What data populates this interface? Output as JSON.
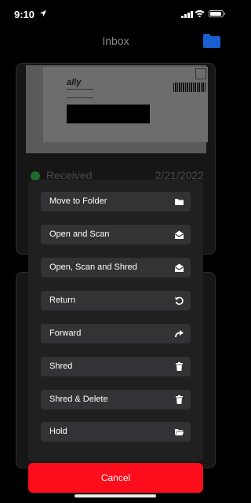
{
  "status_bar": {
    "time": "9:10",
    "icons": [
      "location-arrow-icon",
      "cellular-signal-icon",
      "wifi-icon",
      "battery-icon"
    ]
  },
  "header": {
    "title": "Inbox",
    "folder_icon": "folder-icon",
    "accent_color": "#1a5fd0"
  },
  "mail_card": {
    "envelope_logo": "ally",
    "status": "Received",
    "date": "2/21/2022",
    "status_color": "#1f6b29"
  },
  "action_sheet": {
    "items": [
      {
        "label": "Move to Folder",
        "icon": "folder-icon"
      },
      {
        "label": "Open and Scan",
        "icon": "open-envelope-icon"
      },
      {
        "label": "Open, Scan and Shred",
        "icon": "open-envelope-icon"
      },
      {
        "label": "Return",
        "icon": "return-arrow-icon"
      },
      {
        "label": "Forward",
        "icon": "forward-arrow-icon"
      },
      {
        "label": "Shred",
        "icon": "trash-icon"
      },
      {
        "label": "Shred & Delete",
        "icon": "trash-icon"
      },
      {
        "label": "Hold",
        "icon": "open-folder-icon"
      }
    ],
    "cancel_label": "Cancel",
    "cancel_color": "#fc0d1b"
  }
}
